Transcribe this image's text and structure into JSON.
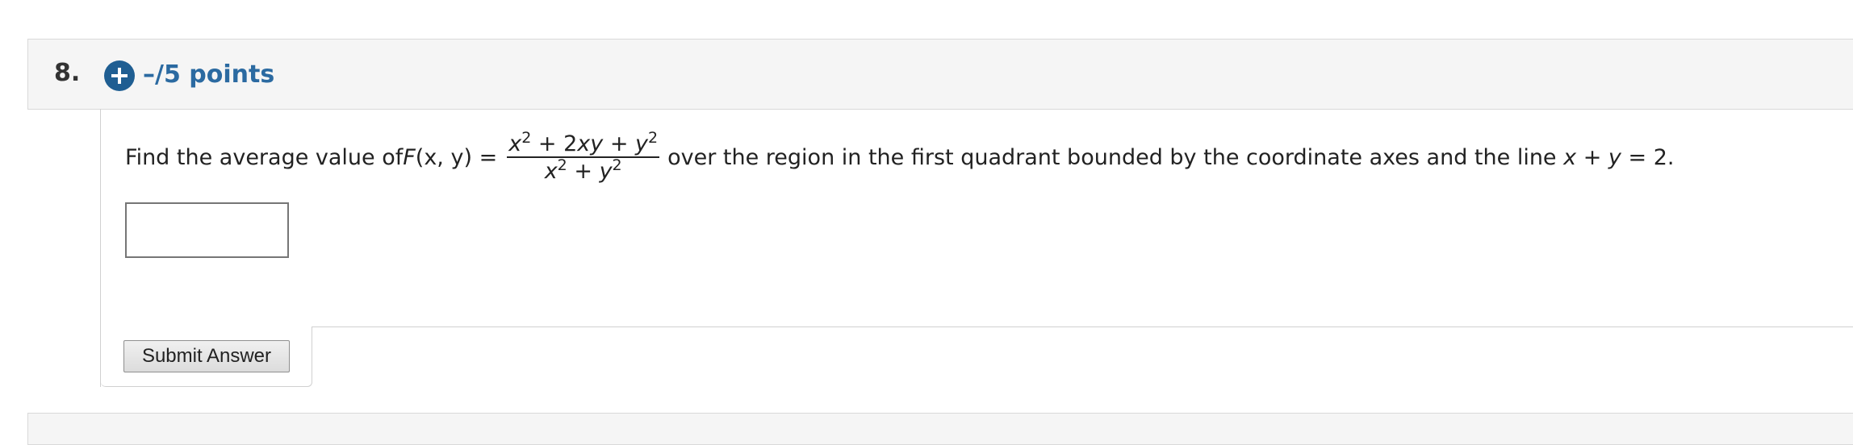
{
  "question": {
    "number": "8.",
    "points": "–/5 points",
    "prompt_before": "Find the average value of ",
    "function_name": "F",
    "function_args": "(x, y)",
    "equals": " = ",
    "numerator": {
      "t1": "x",
      "e1": "2",
      "t2": " + 2",
      "t3": "xy",
      "t4": " + ",
      "t5": "y",
      "e2": "2"
    },
    "denominator": {
      "t1": "x",
      "e1": "2",
      "t2": " + ",
      "t3": "y",
      "e2": "2"
    },
    "prompt_after": "over the region in the first quadrant bounded by the coordinate axes and the line ",
    "line_eq": {
      "x": "x",
      "plus": " + ",
      "y": "y",
      "rest": " = 2."
    },
    "answer_value": "",
    "submit_label": "Submit Answer"
  },
  "icons": {
    "expand": "plus-circle-icon"
  },
  "colors": {
    "accent": "#1f5e92",
    "points_text": "#2b6aa1",
    "header_bg": "#f5f5f5"
  }
}
